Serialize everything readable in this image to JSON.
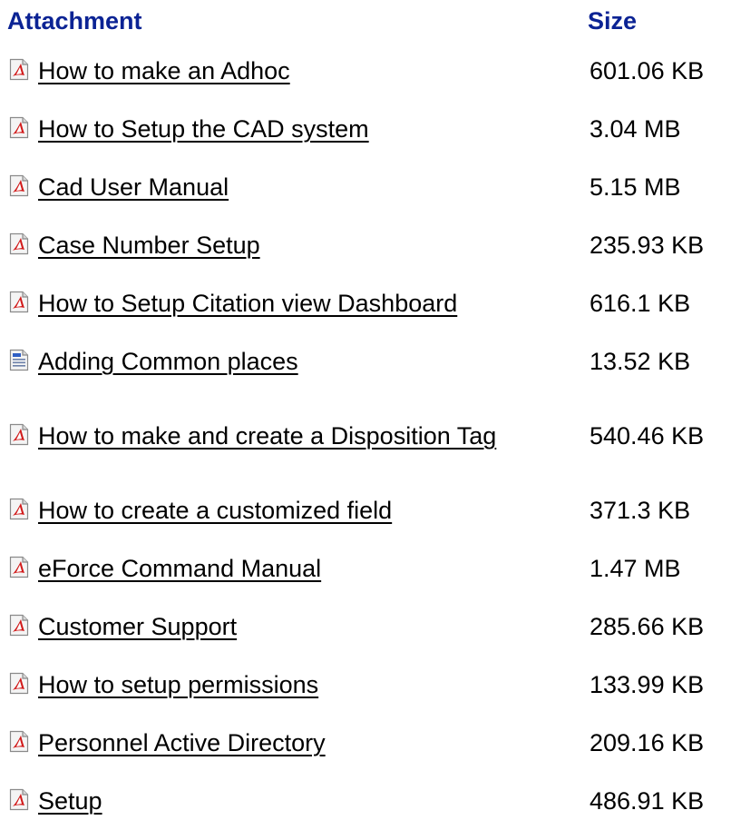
{
  "headers": {
    "attachment": "Attachment",
    "size": "Size"
  },
  "rows": [
    {
      "name": "How to make an Adhoc",
      "size": "601.06 KB",
      "icon": "pdf-icon"
    },
    {
      "name": "How to Setup the CAD system",
      "size": "3.04 MB",
      "icon": "pdf-icon"
    },
    {
      "name": "Cad User Manual",
      "size": "5.15 MB",
      "icon": "pdf-icon"
    },
    {
      "name": "Case Number Setup",
      "size": "235.93 KB",
      "icon": "pdf-icon"
    },
    {
      "name": "How to Setup Citation view Dashboard",
      "size": "616.1 KB",
      "icon": "pdf-icon"
    },
    {
      "name": "Adding Common places",
      "size": "13.52 KB",
      "icon": "document-icon"
    },
    {
      "name": "How to make and create a Disposition Tag",
      "size": "540.46 KB",
      "icon": "pdf-icon"
    },
    {
      "name": "How to create a customized field",
      "size": "371.3 KB",
      "icon": "pdf-icon"
    },
    {
      "name": "eForce Command Manual",
      "size": "1.47 MB",
      "icon": "pdf-icon"
    },
    {
      "name": "Customer Support",
      "size": "285.66 KB",
      "icon": "pdf-icon"
    },
    {
      "name": "How to setup permissions",
      "size": "133.99 KB",
      "icon": "pdf-icon"
    },
    {
      "name": "Personnel Active Directory",
      "size": "209.16 KB",
      "icon": "pdf-icon"
    },
    {
      "name": "Setup",
      "size": "486.91 KB",
      "icon": "pdf-icon"
    }
  ],
  "colors": {
    "header": "#0b2394",
    "pdf_mark": "#d11a1a"
  }
}
